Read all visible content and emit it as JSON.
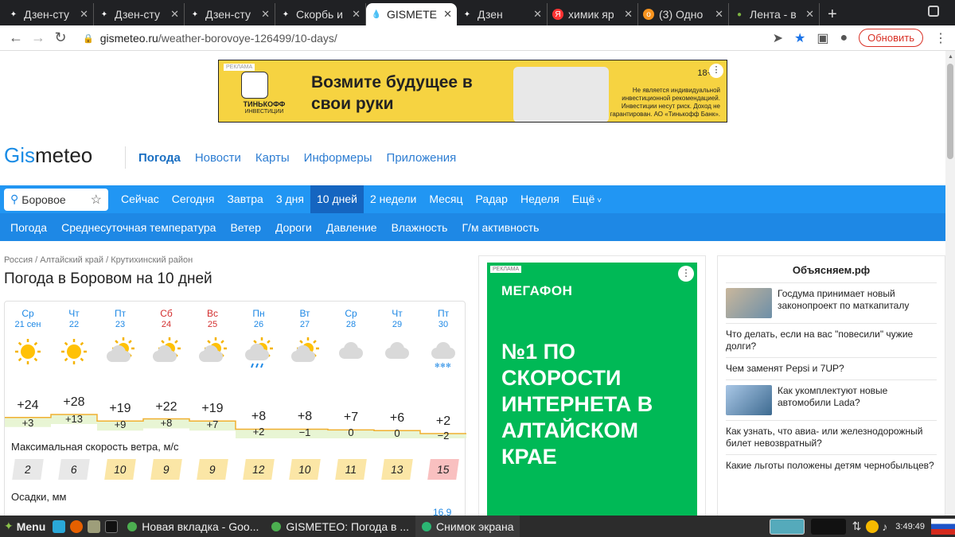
{
  "tabs": [
    {
      "title": "Дзен-сту",
      "icon": "dzen-icon"
    },
    {
      "title": "Дзен-сту",
      "icon": "dzen-icon"
    },
    {
      "title": "Дзен-сту",
      "icon": "dzen-icon"
    },
    {
      "title": "Скорбь и",
      "icon": "dzen-icon"
    },
    {
      "title": "GISMETE",
      "icon": "gismeteo-icon",
      "active": true
    },
    {
      "title": "Дзен",
      "icon": "dzen-icon"
    },
    {
      "title": "химик яр",
      "icon": "yandex-icon"
    },
    {
      "title": "(3) Одно",
      "icon": "ok-icon"
    },
    {
      "title": "Лента - в",
      "icon": "lenta-icon"
    }
  ],
  "url": {
    "domain": "gismeteo.ru",
    "path": "/weather-borovoye-126499/10-days/"
  },
  "update_label": "Обновить",
  "ad_top": {
    "label": "РЕКЛАМА",
    "brand": "ТИНЬКОФФ",
    "brand_sub": "ИНВЕСТИЦИИ",
    "headline": "Возмите будущее в свои руки",
    "disclaimer": "Не является индивидуальной инвестиционной рекомендацией. Инвестиции несут риск. Доход не гарантирован. АО «Тинькофф Банк».",
    "num": "18+",
    "brand_color": "#f6d341"
  },
  "logo": {
    "g": "Gis",
    "rest": "meteo"
  },
  "main_nav": [
    "Погода",
    "Новости",
    "Карты",
    "Информеры",
    "Приложения"
  ],
  "search": {
    "value": "Боровое"
  },
  "periods": [
    "Сейчас",
    "Сегодня",
    "Завтра",
    "3 дня",
    "10 дней",
    "2 недели",
    "Месяц",
    "Радар",
    "Неделя",
    "Ещё"
  ],
  "subnav": [
    "Погода",
    "Среднесуточная температура",
    "Ветер",
    "Дороги",
    "Давление",
    "Влажность",
    "Г/м активность"
  ],
  "breadcrumb": "Россия / Алтайский край / Крутихинский район",
  "title": "Погода в Боровом на 10 дней",
  "days": [
    {
      "wd": "Ср",
      "date": "21 сен",
      "max": "+24",
      "min": "+3",
      "icon": "sun",
      "wind": "2",
      "weekend": false
    },
    {
      "wd": "Чт",
      "date": "22",
      "max": "+28",
      "min": "+13",
      "icon": "sun",
      "wind": "6",
      "weekend": false
    },
    {
      "wd": "Пт",
      "date": "23",
      "max": "+19",
      "min": "+9",
      "icon": "partly-cloudy",
      "wind": "10",
      "weekend": false
    },
    {
      "wd": "Сб",
      "date": "24",
      "max": "+22",
      "min": "+8",
      "icon": "partly-cloudy",
      "wind": "9",
      "weekend": true
    },
    {
      "wd": "Вс",
      "date": "25",
      "max": "+19",
      "min": "+7",
      "icon": "partly-cloudy",
      "wind": "9",
      "weekend": true
    },
    {
      "wd": "Пн",
      "date": "26",
      "max": "+8",
      "min": "+2",
      "icon": "rain",
      "wind": "12",
      "weekend": false
    },
    {
      "wd": "Вт",
      "date": "27",
      "max": "+8",
      "min": "−1",
      "icon": "partly-cloudy",
      "wind": "10",
      "weekend": false
    },
    {
      "wd": "Ср",
      "date": "28",
      "max": "+7",
      "min": "0",
      "icon": "cloudy",
      "wind": "11",
      "weekend": false
    },
    {
      "wd": "Чт",
      "date": "29",
      "max": "+6",
      "min": "0",
      "icon": "cloudy",
      "wind": "13",
      "weekend": false
    },
    {
      "wd": "Пт",
      "date": "30",
      "max": "+2",
      "min": "−2",
      "icon": "snow",
      "wind": "15",
      "weekend": false
    }
  ],
  "wind_label": "Максимальная скорость ветра, м/с",
  "precip_label": "Осадки, мм",
  "precip_value": "16,9",
  "ad_side": {
    "label": "РЕКЛАМА",
    "brand": "МЕГАФОН",
    "headline": "№1 ПО СКОРОСТИ ИНТЕРНЕТА В АЛТАЙСКОМ КРАЕ",
    "brand_color": "#00b956"
  },
  "news": {
    "title": "Объясняем.рф",
    "items": [
      {
        "text": "Госдума принимает новый законопроект по маткапиталу",
        "thumb": true
      },
      {
        "text": "Что делать, если на вас \"повесили\" чужие долги?",
        "thumb": false
      },
      {
        "text": "Чем заменят Pepsi и 7UP?",
        "thumb": false
      },
      {
        "text": "Как укомплектуют новые автомобили Lada?",
        "thumb": true
      },
      {
        "text": "Как узнать, что авиа- или железнодорожный билет невозвратный?",
        "thumb": false
      },
      {
        "text": "Какие льготы положены детям чернобыльцев?",
        "thumb": false
      }
    ]
  },
  "taskbar": {
    "menu": "Menu",
    "tasks": [
      "Новая вкладка - Goo...",
      "GISMETEO: Погода в ...",
      "Снимок экрана"
    ],
    "clock": "3:49:49"
  }
}
